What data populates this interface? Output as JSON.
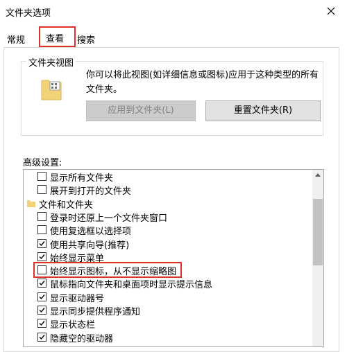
{
  "window": {
    "title": "文件夹选项"
  },
  "tabs": [
    {
      "label": "常规"
    },
    {
      "label": "查看",
      "selected": true
    },
    {
      "label": "搜索"
    }
  ],
  "folder_views": {
    "title": "文件夹视图",
    "description": "你可以将此视图(如详细信息或图标)应用于这种类型的所有文件夹。",
    "apply_button": "应用到文件夹(L)",
    "reset_button": "重置文件夹(R)"
  },
  "advanced": {
    "label": "高级设置:",
    "items": [
      {
        "label": "显示所有文件夹",
        "checked": false,
        "kind": "checkbox"
      },
      {
        "label": "展开到打开的文件夹",
        "checked": false,
        "kind": "checkbox"
      },
      {
        "label": "文件和文件夹",
        "kind": "folder"
      },
      {
        "label": "登录时还原上一个文件夹窗口",
        "checked": false,
        "kind": "checkbox"
      },
      {
        "label": "使用复选框以选择项",
        "checked": false,
        "kind": "checkbox"
      },
      {
        "label": "使用共享向导(推荐)",
        "checked": true,
        "kind": "checkbox"
      },
      {
        "label": "始终显示菜单",
        "checked": true,
        "kind": "checkbox"
      },
      {
        "label": "始终显示图标，从不显示缩略图",
        "checked": false,
        "kind": "checkbox",
        "highlighted": true
      },
      {
        "label": "鼠标指向文件夹和桌面项时显示提示信息",
        "checked": true,
        "kind": "checkbox"
      },
      {
        "label": "显示驱动器号",
        "checked": true,
        "kind": "checkbox"
      },
      {
        "label": "显示同步提供程序通知",
        "checked": true,
        "kind": "checkbox"
      },
      {
        "label": "显示状态栏",
        "checked": true,
        "kind": "checkbox"
      },
      {
        "label": "隐藏空的驱动器",
        "checked": true,
        "kind": "checkbox"
      }
    ]
  },
  "colors": {
    "highlight": "#e0302a",
    "folder": "#f2d37a"
  }
}
